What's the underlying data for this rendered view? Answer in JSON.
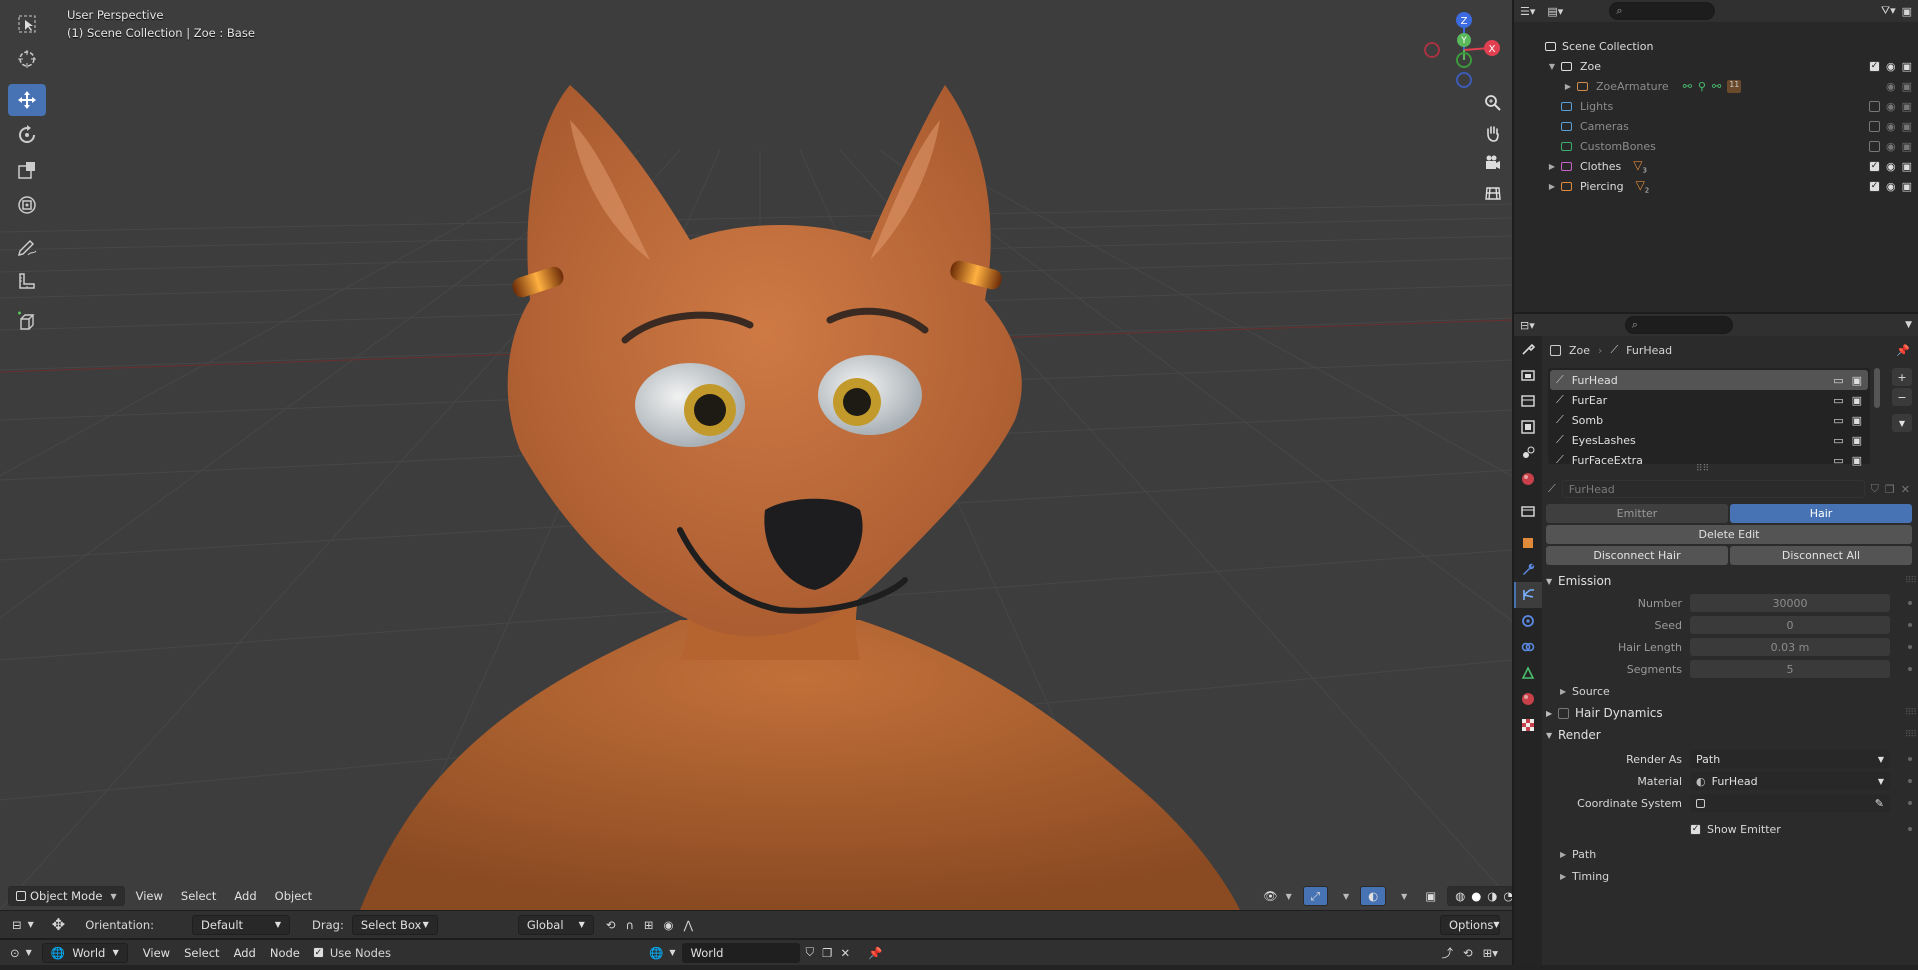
{
  "viewport": {
    "perspective_label": "User Perspective",
    "collection_label": "(1) Scene Collection | Zoe  : Base",
    "gizmo_axes": {
      "z": "Z",
      "y": "Y",
      "x": "X"
    },
    "tools": [
      {
        "name": "select-box-tool",
        "icon": "select-box-icon",
        "active": false
      },
      {
        "name": "cursor-tool",
        "icon": "cursor-icon",
        "active": false
      },
      {
        "name": "move-tool",
        "icon": "move-icon",
        "active": true
      },
      {
        "name": "rotate-tool",
        "icon": "rotate-icon",
        "active": false
      },
      {
        "name": "scale-tool",
        "icon": "scale-icon",
        "active": false
      },
      {
        "name": "transform-tool",
        "icon": "transform-icon",
        "active": false
      },
      {
        "name": "annotate-tool",
        "icon": "annotate-icon",
        "active": false
      },
      {
        "name": "measure-tool",
        "icon": "measure-icon",
        "active": false
      },
      {
        "name": "add-cube-tool",
        "icon": "add-cube-icon",
        "active": false
      }
    ],
    "header": {
      "mode": "Object Mode",
      "menus": [
        "View",
        "Select",
        "Add",
        "Object"
      ]
    }
  },
  "tool_settings": {
    "orientation_label": "Orientation:",
    "orientation_value": "Default",
    "drag_label": "Drag:",
    "drag_value": "Select Box",
    "transform_orientation": "Global",
    "options_label": "Options"
  },
  "node_header": {
    "editor_type": "World",
    "menus": [
      "View",
      "Select",
      "Add",
      "Node"
    ],
    "use_nodes_label": "Use Nodes",
    "use_nodes_checked": true,
    "world_name": "World"
  },
  "outliner": {
    "root": "Scene Collection",
    "rows": [
      {
        "label": "Zoe",
        "indent": 1,
        "expanded": true,
        "dim": false,
        "check": "on",
        "icon_color": "#dddddd"
      },
      {
        "label": "ZoeArmature",
        "indent": 2,
        "expanded": false,
        "dim": true,
        "check": "none",
        "icon_color": "#d08a4a"
      },
      {
        "label": "Lights",
        "indent": 1,
        "expanded": null,
        "dim": true,
        "check": "off",
        "icon_color": "#5aa0d8"
      },
      {
        "label": "Cameras",
        "indent": 1,
        "expanded": null,
        "dim": true,
        "check": "off",
        "icon_color": "#5aa0d8"
      },
      {
        "label": "CustomBones",
        "indent": 1,
        "expanded": null,
        "dim": true,
        "check": "off",
        "icon_color": "#3cae6b"
      },
      {
        "label": "Clothes",
        "indent": 1,
        "expanded": false,
        "dim": false,
        "check": "on",
        "icon_color": "#c861c8"
      },
      {
        "label": "Piercing",
        "indent": 1,
        "expanded": false,
        "dim": false,
        "check": "on",
        "icon_color": "#e08a3a"
      }
    ],
    "badges": {
      "armature_count": "11",
      "clothes_count": "3",
      "piercing_count": "2"
    }
  },
  "properties": {
    "breadcrumb_object": "Zoe",
    "breadcrumb_system": "FurHead",
    "particle_systems": [
      "FurHead",
      "FurEar",
      "Somb",
      "EyesLashes",
      "FurFaceExtra"
    ],
    "selected_system": "FurHead",
    "settings_name": "FurHead",
    "type_options": [
      "Emitter",
      "Hair"
    ],
    "type_selected": "Hair",
    "delete_edit_label": "Delete Edit",
    "disconnect_hair_label": "Disconnect Hair",
    "disconnect_all_label": "Disconnect All",
    "emission": {
      "title": "Emission",
      "fields": [
        {
          "label": "Number",
          "value": "30000"
        },
        {
          "label": "Seed",
          "value": "0"
        },
        {
          "label": "Hair Length",
          "value": "0.03 m"
        },
        {
          "label": "Segments",
          "value": "5"
        }
      ],
      "source_label": "Source"
    },
    "hair_dynamics_label": "Hair Dynamics",
    "render": {
      "title": "Render",
      "render_as_label": "Render As",
      "render_as_value": "Path",
      "material_label": "Material",
      "material_value": "FurHead",
      "coord_label": "Coordinate System",
      "coord_value": "",
      "show_emitter_label": "Show Emitter",
      "show_emitter_checked": true,
      "path_label": "Path",
      "timing_label": "Timing"
    }
  },
  "colors": {
    "accent": "#4772b3",
    "viewport_bg": "#3d3d3d",
    "fur": "#c8713f"
  }
}
